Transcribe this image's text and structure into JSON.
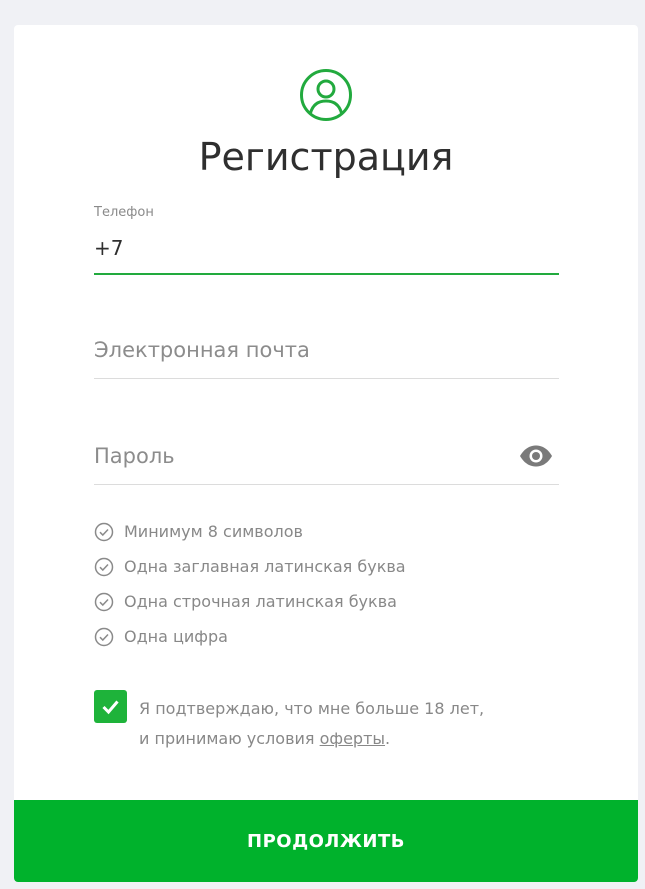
{
  "colors": {
    "accent": "#00b22c",
    "checkbox": "#1eb33a",
    "icon_green": "#22aa3e",
    "muted_text": "#888888",
    "background": "#f0f1f5"
  },
  "header": {
    "icon": "user-circle-icon",
    "title": "Регистрация"
  },
  "form": {
    "phone": {
      "label": "Телефон",
      "value": "+7"
    },
    "email": {
      "placeholder": "Электронная почта",
      "value": ""
    },
    "password": {
      "placeholder": "Пароль",
      "value": "",
      "toggle_icon": "eye-icon"
    }
  },
  "password_rules": [
    {
      "text": "Минимум 8 символов",
      "icon": "check-circle-icon"
    },
    {
      "text": "Одна заглавная латинская буква",
      "icon": "check-circle-icon"
    },
    {
      "text": "Одна строчная латинская буква",
      "icon": "check-circle-icon"
    },
    {
      "text": "Одна цифра",
      "icon": "check-circle-icon"
    }
  ],
  "agreement": {
    "checked": true,
    "text_line1": "Я подтверждаю, что мне больше 18 лет,",
    "text_line2_prefix": "и принимаю условия ",
    "link_text": "оферты",
    "text_suffix": "."
  },
  "submit": {
    "label": "ПРОДОЛЖИТЬ"
  }
}
